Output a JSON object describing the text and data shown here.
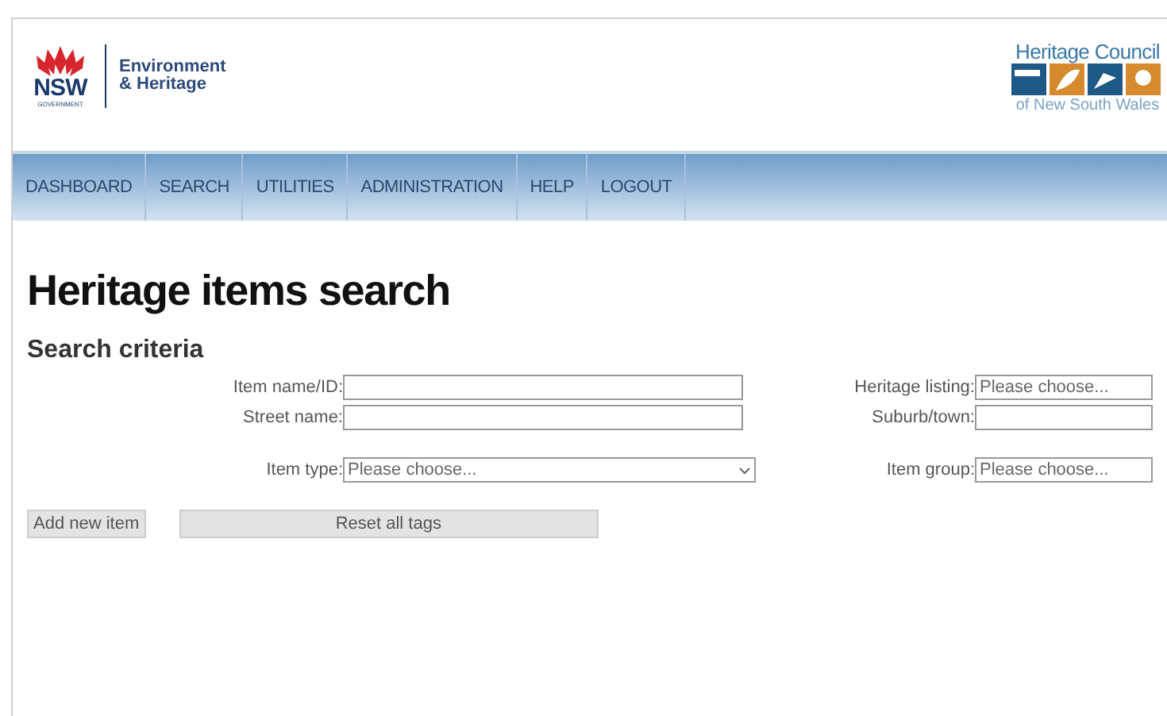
{
  "header": {
    "nsw_logo": {
      "wordmark": "NSW",
      "sub": "GOVERNMENT"
    },
    "agency": [
      "Environment",
      "& Heritage"
    ],
    "council_logo": {
      "title": "Heritage Council",
      "subtitle": "of New South Wales"
    }
  },
  "nav": [
    {
      "label": "DASHBOARD"
    },
    {
      "label": "SEARCH"
    },
    {
      "label": "UTILITIES"
    },
    {
      "label": "ADMINISTRATION"
    },
    {
      "label": "HELP"
    },
    {
      "label": "LOGOUT"
    }
  ],
  "page_title": "Heritage items search",
  "section_title": "Search criteria",
  "fields": [
    {
      "kind": "text",
      "label": "Item name/ID:"
    },
    {
      "kind": "select",
      "label": "Heritage listing:",
      "placeholder": "Please choose..."
    },
    {
      "kind": "text",
      "label": "Street name:"
    },
    {
      "kind": "text",
      "label": "Suburb/town:"
    },
    {
      "kind": "select",
      "label": "Item type:",
      "placeholder": "Please choose..."
    },
    {
      "kind": "select",
      "label": "Item group:",
      "placeholder": "Please choose..."
    }
  ],
  "buttons": [
    {
      "label": "Add new item",
      "kind": "small"
    },
    {
      "label": "Reset all tags",
      "kind": "wide"
    }
  ]
}
